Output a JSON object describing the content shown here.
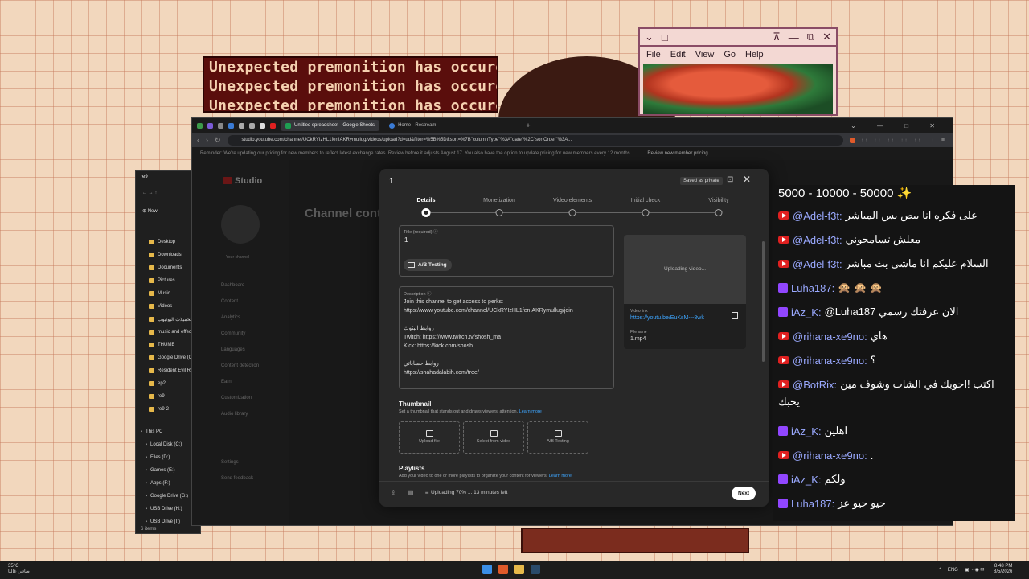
{
  "banner": {
    "lines": [
      "Unexpected premonition has occured",
      "Unexpected premonition has occured",
      "Unexpected premonition has occured"
    ]
  },
  "retro_window": {
    "menu": [
      "File",
      "Edit",
      "View",
      "Go",
      "Help"
    ]
  },
  "explorer": {
    "items": [
      "Desktop",
      "Downloads",
      "Documents",
      "Pictures",
      "Music",
      "Videos",
      "تحميلات اليوتيوب",
      "music and effects",
      "THUMB",
      "Google Drive (G:)",
      "Resident Evil Re",
      "ep2",
      "re9",
      "re9-2"
    ],
    "tree": [
      "This PC",
      "Local Disk (C:)",
      "Files (D:)",
      "Games (E:)",
      "Apps (F:)",
      "Google Drive (G:)",
      "USB Drive (H:)",
      "USB Drive (I:)"
    ],
    "new_label": "New",
    "title": "re9",
    "status": "6 items"
  },
  "browser": {
    "tabs": [
      "Untitled spreadsheet - Google Sheets",
      "Home - Restream"
    ],
    "url": "studio.youtube.com/channel/UCkRYIzHL1fenIAKRymullug/videos/upload?d=ud&filter=%5B%5D&sort=%7B\"columnType\"%3A\"date\"%2C\"sortOrder\"%3A...",
    "notice": "Reminder: We're updating our pricing for new members to reflect latest exchange rates. Review before it adjusts August 17. You also have the option to update pricing for new members every 12 months.",
    "notice_link": "Review new member pricing"
  },
  "studio": {
    "logo": "Studio",
    "page_title": "Channel content",
    "your_channel": "Your channel",
    "side": [
      "Dashboard",
      "Content",
      "Analytics",
      "Community",
      "Languages",
      "Content detection",
      "Earn",
      "Customization",
      "Audio library",
      "Settings",
      "Send feedback"
    ]
  },
  "dialog": {
    "title": "1",
    "saved": "Saved as private",
    "steps": [
      "Details",
      "Monetization",
      "Video elements",
      "Initial check",
      "Visibility"
    ],
    "title_label": "Title (required)",
    "title_value": "1",
    "ab_testing": "A/B Testing",
    "desc_label": "Description",
    "desc_lines": [
      "Join this channel to get access to perks:",
      "https://www.youtube.com/channel/UCkRYIzHL1fenIAKRymullug/join",
      "",
      "روابط البثوث",
      "Twitch: https://www.twitch.tv/shosh_ma",
      "Kick: https://kick.com/shosh",
      "",
      "روابط حساباتي",
      "https://shahadalabih.com/tree/"
    ],
    "thumb_heading": "Thumbnail",
    "thumb_sub": "Set a thumbnail that stands out and draws viewers' attention.",
    "learn_more": "Learn more",
    "thumb_buttons": [
      "Upload file",
      "Select from video",
      "A/B Testing"
    ],
    "playlists_heading": "Playlists",
    "playlists_sub": "Add your video to one or more playlists to organize your content for viewers.",
    "uploading": "Uploading video...",
    "video_link_label": "Video link",
    "video_link": "https://youtu.be/EuKsM---8wk",
    "filename_label": "Filename",
    "filename": "1.mp4",
    "upload_status": "Uploading 70% ... 13 minutes left",
    "next": "Next"
  },
  "chat": {
    "header": "5000 - 10000 - 50000 ✨",
    "messages": [
      {
        "p": "youtube",
        "user": "@Adel-f3t:",
        "text": "على فكره انا ببص بس المباشر"
      },
      {
        "p": "youtube",
        "user": "@Adel-f3t:",
        "text": "معلش تسامحوني"
      },
      {
        "p": "youtube",
        "user": "@Adel-f3t:",
        "text": "السلام عليكم انا ماشي بث مباشر"
      },
      {
        "p": "twitch",
        "user": "Luha187:",
        "text": "🙊 🙊 🙊"
      },
      {
        "p": "twitch",
        "user": "iAz_K:",
        "text": "@Luha187 الان عرفتك رسمي"
      },
      {
        "p": "youtube",
        "user": "@rihana-xe9no:",
        "text": "هاي"
      },
      {
        "p": "youtube",
        "user": "@rihana-xe9no:",
        "text": "؟"
      },
      {
        "p": "youtube",
        "user": "@BotRix:",
        "text": "اكتب !احوبك في الشات وشوف مين"
      },
      {
        "p": "none",
        "user": "",
        "text": "يحبك"
      },
      {
        "p": "twitch",
        "user": "iAz_K:",
        "text": "اهلين"
      },
      {
        "p": "youtube",
        "user": "@rihana-xe9no:",
        "text": "."
      },
      {
        "p": "twitch",
        "user": "iAz_K:",
        "text": "ولكم"
      },
      {
        "p": "twitch",
        "user": "Luha187:",
        "text": "حيو حيو عز"
      }
    ]
  },
  "taskbar": {
    "temp": "35°C",
    "weather": "صافي غالبا",
    "lang": "ENG",
    "time": "8:48 PM",
    "date": "8/5/2026"
  }
}
